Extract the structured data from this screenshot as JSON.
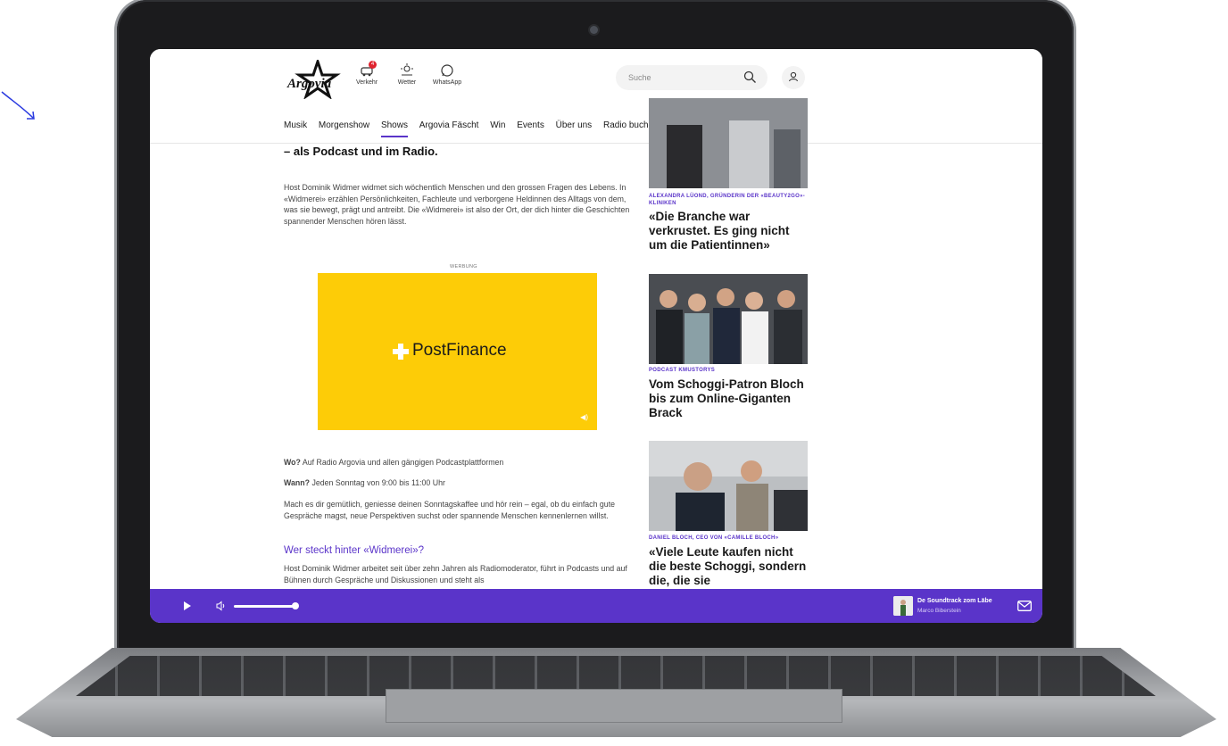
{
  "site": {
    "logo_text": "Argovia",
    "quicklinks": [
      {
        "label": "Verkehr",
        "icon": "traffic-icon",
        "badge": "4"
      },
      {
        "label": "Wetter",
        "icon": "weather-icon"
      },
      {
        "label": "WhatsApp",
        "icon": "whatsapp-icon"
      }
    ],
    "search_placeholder": "Suche",
    "nav": [
      "Musik",
      "Morgenshow",
      "Shows",
      "Argovia Fäscht",
      "Win",
      "Events",
      "Über uns",
      "Radio buchen"
    ],
    "nav_active": "Shows"
  },
  "article": {
    "subtitle": "– als Podcast und im Radio.",
    "intro": "Host Dominik Widmer widmet sich wöchentlich Menschen und den grossen Fragen des Lebens. In «Widmerei» erzählen Persönlichkeiten, Fachleute und verborgene Heldinnen des Alltags von dem, was sie bewegt, prägt und antreibt. Die «Widmerei» ist also der Ort, der dich hinter die Geschichten spannender Menschen hören lässt.",
    "ad_label": "WERBUNG",
    "ad_brand": "PostFinance",
    "where_label": "Wo?",
    "where_text": " Auf Radio Argovia und allen gängigen Podcastplattformen",
    "when_label": "Wann?",
    "when_text": " Jeden Sonntag von 9:00 bis 11:00 Uhr",
    "cta": "Mach es dir gemütlich, geniesse deinen Sonntagskaffee und hör rein – egal, ob du einfach gute Gespräche magst, neue Perspektiven suchst oder spannende Menschen kennenlernen willst.",
    "section_heading": "Wer steckt hinter «Widmerei»?",
    "section_text": "Host Dominik Widmer arbeitet seit über zehn Jahren als Radiomoderator, führt in Podcasts und auf Bühnen durch Gespräche und Diskussionen und steht als"
  },
  "sidebar": {
    "cards": [
      {
        "kicker": "ALEXANDRA LÜOND, GRÜNDERIN DER «BEAUTY2GO»-KLINIKEN",
        "title": "«Die Branche war verkrustet. Es ging nicht um die Patientinnen»"
      },
      {
        "kicker": "PODCAST KMUSTORYS",
        "title": "Vom Schoggi-Patron Bloch bis zum Online-Giganten Brack"
      },
      {
        "kicker": "DANIEL BLOCH, CEO VON «CAMILLE BLOCH»",
        "title": "«Viele Leute kaufen nicht die beste Schoggi, sondern die, die sie"
      }
    ]
  },
  "player": {
    "now_playing_title": "De Soundtrack zom Läbe",
    "now_playing_artist": "Marco Biberstein",
    "volume": 0.8
  },
  "colors": {
    "accent": "#5a34c9",
    "ad_yellow": "#fdcc07",
    "backdrop_yellow": "#f7ef1c"
  }
}
